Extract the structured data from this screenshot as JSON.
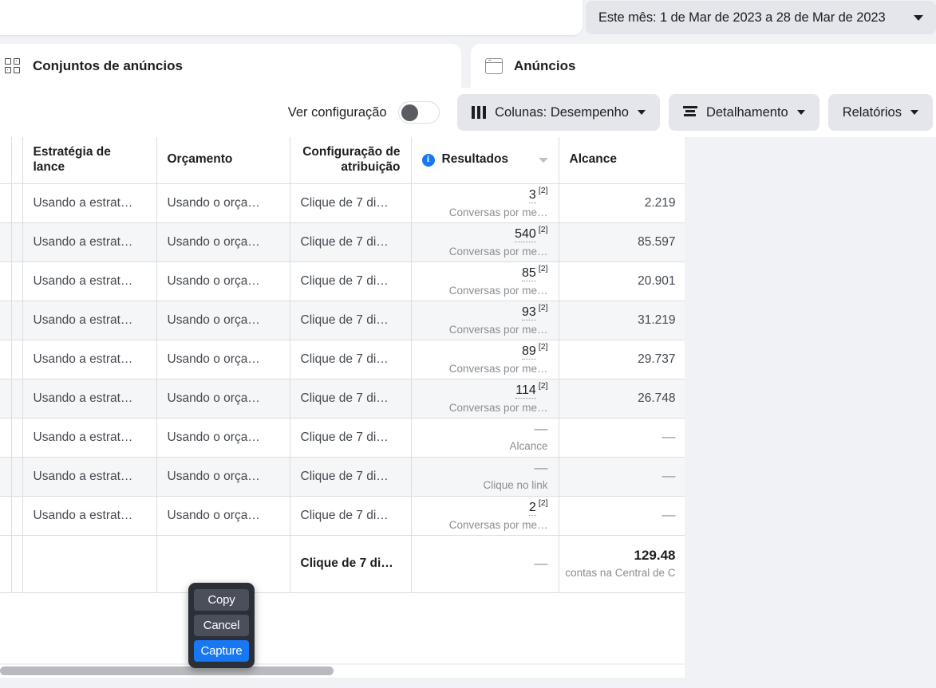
{
  "header": {
    "date_range": "Este mês: 1 de Mar de 2023 a 28 de Mar de 2023",
    "date_caret_icon": "chevron-down-icon"
  },
  "tabs": [
    {
      "label": "Conjuntos de anúncios",
      "icon": "grid-icon",
      "active": true
    },
    {
      "label": "Anúncios",
      "icon": "window-icon",
      "active": false
    }
  ],
  "toolbar": {
    "view_config_label": "Ver configuração",
    "toggle_state": "off",
    "columns_label": "Colunas: Desempenho",
    "columns_icon": "columns-icon",
    "breakdown_label": "Detalhamento",
    "breakdown_icon": "breakdown-icon",
    "reports_label": "Relatórios",
    "caret_icon": "chevron-down-icon"
  },
  "table": {
    "headers": [
      {
        "label": "Estratégia de lance",
        "align": "left"
      },
      {
        "label": "Orçamento",
        "align": "left"
      },
      {
        "label": "Configuração de atribuição",
        "align": "right"
      },
      {
        "label": "Resultados",
        "align": "left",
        "info_icon": "info-icon",
        "sort_icon": "sort-caret-icon"
      },
      {
        "label": "Alcance",
        "align": "left"
      }
    ],
    "rows": [
      {
        "bid": "Usando a estrat…",
        "budget": "Usando o orça…",
        "attribution": "Clique de 7 di…",
        "result_value": "3",
        "result_sup": "[2]",
        "result_sub": "Conversas por me…",
        "reach": "2.219"
      },
      {
        "bid": "Usando a estrat…",
        "budget": "Usando o orça…",
        "attribution": "Clique de 7 di…",
        "result_value": "540",
        "result_sup": "[2]",
        "result_sub": "Conversas por me…",
        "reach": "85.597"
      },
      {
        "bid": "Usando a estrat…",
        "budget": "Usando o orça…",
        "attribution": "Clique de 7 di…",
        "result_value": "85",
        "result_sup": "[2]",
        "result_sub": "Conversas por me…",
        "reach": "20.901"
      },
      {
        "bid": "Usando a estrat…",
        "budget": "Usando o orça…",
        "attribution": "Clique de 7 di…",
        "result_value": "93",
        "result_sup": "[2]",
        "result_sub": "Conversas por me…",
        "reach": "31.219"
      },
      {
        "bid": "Usando a estrat…",
        "budget": "Usando o orça…",
        "attribution": "Clique de 7 di…",
        "result_value": "89",
        "result_sup": "[2]",
        "result_sub": "Conversas por me…",
        "reach": "29.737"
      },
      {
        "bid": "Usando a estrat…",
        "budget": "Usando o orça…",
        "attribution": "Clique de 7 di…",
        "result_value": "114",
        "result_sup": "[2]",
        "result_sub": "Conversas por me…",
        "reach": "26.748"
      },
      {
        "bid": "Usando a estrat…",
        "budget": "Usando o orça…",
        "attribution": "Clique de 7 di…",
        "result_value": "—",
        "result_sup": "",
        "result_sub": "Alcance",
        "reach": "—"
      },
      {
        "bid": "Usando a estrat…",
        "budget": "Usando o orça…",
        "attribution": "Clique de 7 di…",
        "result_value": "—",
        "result_sup": "",
        "result_sub": "Clique no link",
        "reach": "—"
      },
      {
        "bid": "Usando a estrat…",
        "budget": "Usando o orça…",
        "attribution": "Clique de 7 di…",
        "result_value": "2",
        "result_sup": "[2]",
        "result_sub": "Conversas por me…",
        "reach": "—"
      }
    ],
    "total_row": {
      "bid": "",
      "budget": "",
      "attribution": "Clique de 7 di…",
      "result_value": "—",
      "result_sub": "",
      "reach": "129.48",
      "reach_sub": "contas na Central de C"
    }
  },
  "capture_popup": {
    "copy_label": "Copy",
    "cancel_label": "Cancel",
    "capture_label": "Capture",
    "accent_color": "#1877f2",
    "background_color": "#2b2f38"
  },
  "scrollbar": {
    "orientation": "horizontal"
  }
}
